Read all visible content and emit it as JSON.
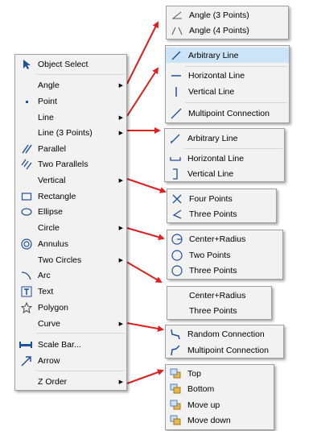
{
  "main_menu": {
    "items": [
      {
        "label": "Object Select",
        "icon": "cursor-icon",
        "has_submenu": false
      },
      {
        "label": "Angle",
        "icon": "",
        "has_submenu": true
      },
      {
        "label": "Point",
        "icon": "point-icon",
        "has_submenu": false
      },
      {
        "label": "Line",
        "icon": "",
        "has_submenu": true
      },
      {
        "label": "Line (3 Points)",
        "icon": "",
        "has_submenu": true
      },
      {
        "label": "Parallel",
        "icon": "parallel-icon",
        "has_submenu": false
      },
      {
        "label": "Two Parallels",
        "icon": "two-parallels-icon",
        "has_submenu": false
      },
      {
        "label": "Vertical",
        "icon": "",
        "has_submenu": true
      },
      {
        "label": "Rectangle",
        "icon": "rectangle-icon",
        "has_submenu": false
      },
      {
        "label": "Ellipse",
        "icon": "ellipse-icon",
        "has_submenu": false
      },
      {
        "label": "Circle",
        "icon": "",
        "has_submenu": true
      },
      {
        "label": "Annulus",
        "icon": "annulus-icon",
        "has_submenu": false
      },
      {
        "label": "Two Circles",
        "icon": "",
        "has_submenu": true
      },
      {
        "label": "Arc",
        "icon": "arc-icon",
        "has_submenu": false
      },
      {
        "label": "Text",
        "icon": "text-icon",
        "has_submenu": false
      },
      {
        "label": "Polygon",
        "icon": "polygon-icon",
        "has_submenu": false
      },
      {
        "label": "Curve",
        "icon": "",
        "has_submenu": true
      },
      {
        "label": "Scale Bar...",
        "icon": "scale-bar-icon",
        "has_submenu": false
      },
      {
        "label": "Arrow",
        "icon": "arrow-icon",
        "has_submenu": false
      },
      {
        "label": "Z Order",
        "icon": "",
        "has_submenu": true
      }
    ]
  },
  "submenus": {
    "angle": [
      "Angle (3 Points)",
      "Angle (4 Points)"
    ],
    "line": [
      "Arbitrary Line",
      "Horizontal Line",
      "Vertical Line",
      "Multipoint Connection"
    ],
    "line3": [
      "Arbitrary Line",
      "Horizontal Line",
      "Vertical Line"
    ],
    "vertical": [
      "Four Points",
      "Three Points"
    ],
    "circle": [
      "Center+Radius",
      "Two Points",
      "Three Points"
    ],
    "two_circles": [
      "Center+Radius",
      "Three Points"
    ],
    "curve": [
      "Random Connection",
      "Multipoint Connection"
    ],
    "z_order": [
      "Top",
      "Bottom",
      "Move up",
      "Move down"
    ]
  },
  "colors": {
    "arrow": "#e02020",
    "menu_bg": "#f2f2f2",
    "highlight": "#cce4f7",
    "icon_blue": "#1f4fa0"
  }
}
